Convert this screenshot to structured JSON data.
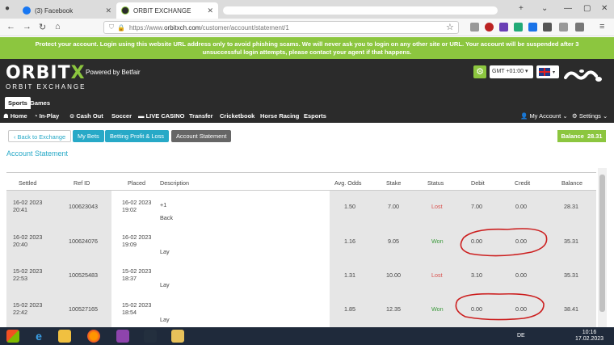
{
  "browser": {
    "tabs": [
      {
        "label": "(3) Facebook"
      },
      {
        "label": "ORBIT EXCHANGE"
      }
    ],
    "url_prefix": "https://www.",
    "url_domain": "orbitxch.com",
    "url_path": "/customer/account/statement/1"
  },
  "banner": {
    "line1": "Protect your account. Login using this website URL address only to avoid phishing scams. We will never ask you to login on any other site or URL. Your account will be suspended after 3",
    "line2": "unsuccessful login attempts, please contact your agent if that happens."
  },
  "header": {
    "logo_main": "ORBIT",
    "logo_x": "X",
    "powered": "Powered by Betfair",
    "sub": "ORBIT EXCHANGE",
    "gmt": "GMT +01:00",
    "gmt_arrow": "▾"
  },
  "sections": {
    "sports": "Sports",
    "games": "Games"
  },
  "menu": {
    "home": "Home",
    "inplay": "In-Play",
    "cashout": "Cash Out",
    "soccer": "Soccer",
    "live_casino": "LIVE CASINO",
    "transfer": "Transfer",
    "cricketbook": "Cricketbook",
    "horse_racing": "Horse Racing",
    "esports": "Esports",
    "my_account": "My Account",
    "settings": "Settings"
  },
  "actions": {
    "back": "Back to Exchange",
    "my_bets": "My Bets",
    "profit_loss": "Betting Profit & Loss",
    "account_statement": "Account Statement",
    "balance_label": "Balance",
    "balance_value": "28.31"
  },
  "page_title": "Account Statement",
  "table": {
    "headers": {
      "settled": "Settled",
      "ref": "Ref ID",
      "placed": "Placed",
      "description": "Description",
      "odds": "Avg. Odds",
      "stake": "Stake",
      "status": "Status",
      "debit": "Debit",
      "credit": "Credit",
      "balance": "Balance"
    },
    "rows": [
      {
        "settled_date": "16-02 2023",
        "settled_time": "20:41",
        "ref": "100623043",
        "placed_date": "16-02 2023",
        "placed_time": "19:02",
        "desc_top": "+1",
        "desc_type": "Back",
        "odds": "1.50",
        "stake": "7.00",
        "status": "Lost",
        "debit": "7.00",
        "credit": "0.00",
        "balance": "28.31"
      },
      {
        "settled_date": "16-02 2023",
        "settled_time": "20:40",
        "ref": "100624076",
        "placed_date": "16-02 2023",
        "placed_time": "19:09",
        "desc_top": "",
        "desc_type": "Lay",
        "odds": "1.16",
        "stake": "9.05",
        "status": "Won",
        "debit": "0.00",
        "credit": "0.00",
        "balance": "35.31"
      },
      {
        "settled_date": "15-02 2023",
        "settled_time": "22:53",
        "ref": "100525483",
        "placed_date": "15-02 2023",
        "placed_time": "18:37",
        "desc_top": "",
        "desc_type": "Lay",
        "odds": "1.31",
        "stake": "10.00",
        "status": "Lost",
        "debit": "3.10",
        "credit": "0.00",
        "balance": "35.31"
      },
      {
        "settled_date": "15-02 2023",
        "settled_time": "22:42",
        "ref": "100527165",
        "placed_date": "15-02 2023",
        "placed_time": "18:54",
        "desc_top": "",
        "desc_type": "Lay",
        "odds": "1.85",
        "stake": "12.35",
        "status": "Won",
        "debit": "0.00",
        "credit": "0.00",
        "balance": "38.41"
      }
    ]
  },
  "taskbar": {
    "lang": "DE",
    "time": "10:16",
    "date": "17.02.2023"
  },
  "colors": {
    "accent_green": "#8cc63f",
    "accent_blue": "#27a9c7",
    "dark": "#2b2b2b",
    "lost": "#d9534f",
    "won": "#3c9a3c",
    "annotation_red": "#cc1f1f"
  }
}
